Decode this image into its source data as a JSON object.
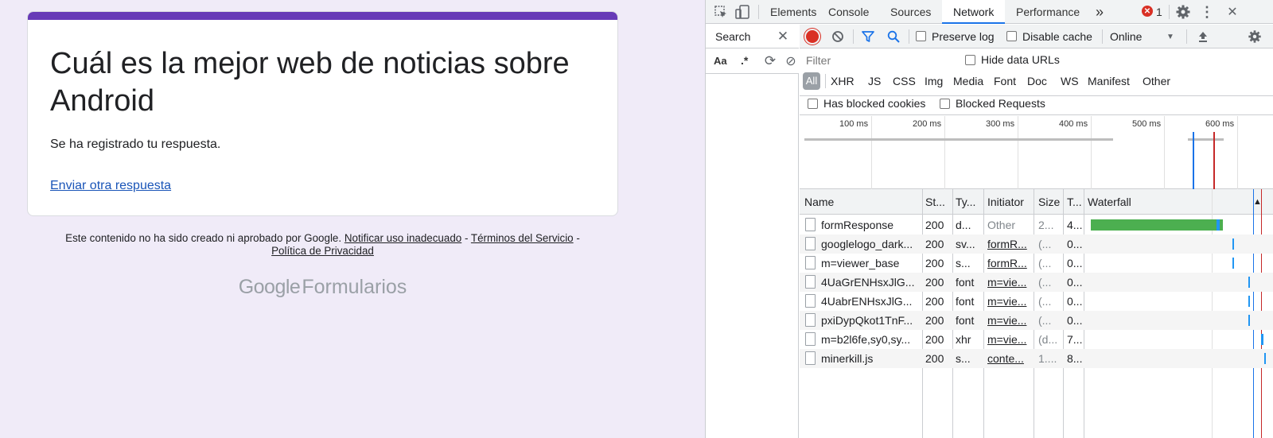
{
  "form": {
    "title": "Cuál es la mejor web de noticias sobre Android",
    "message": "Se ha registrado tu respuesta.",
    "another_link": "Enviar otra respuesta",
    "footer": {
      "disclaimer": "Este contenido no ha sido creado ni aprobado por Google.",
      "report_link": "Notificar uso inadecuado",
      "dash1": " - ",
      "terms_link": "Términos del Servicio",
      "dash2": " -",
      "privacy_link": "Política de Privacidad"
    },
    "brand": {
      "google": "Google",
      "product": "Formularios"
    },
    "colors": {
      "accent": "#673ab7",
      "background": "#f0ebf8"
    }
  },
  "devtools": {
    "tabs": [
      {
        "label": "Elements"
      },
      {
        "label": "Console"
      },
      {
        "label": "Sources"
      },
      {
        "label": "Network",
        "active": true
      },
      {
        "label": "Performance"
      }
    ],
    "more_tabs_glyph": "»",
    "error_count": "1",
    "search": {
      "title": "Search",
      "case_toggle": "Aa",
      "regex_toggle": ".*"
    },
    "network": {
      "preserve_log": "Preserve log",
      "disable_cache": "Disable cache",
      "throttling": "Online",
      "filter_placeholder": "Filter",
      "hide_data_urls": "Hide data URLs",
      "types": [
        "All",
        "XHR",
        "JS",
        "CSS",
        "Img",
        "Media",
        "Font",
        "Doc",
        "WS",
        "Manifest",
        "Other"
      ],
      "has_blocked_cookies": "Has blocked cookies",
      "blocked_requests": "Blocked Requests",
      "overview_ticks": [
        "100 ms",
        "200 ms",
        "300 ms",
        "400 ms",
        "500 ms",
        "600 ms"
      ],
      "columns": {
        "name": "Name",
        "status": "St...",
        "type": "Ty...",
        "initiator": "Initiator",
        "size": "Size",
        "time": "T...",
        "waterfall": "Waterfall"
      },
      "sort_glyph": "▲",
      "rows": [
        {
          "name": "formResponse",
          "status": "200",
          "type": "d...",
          "initiator": "Other",
          "initiator_link": false,
          "size": "2...",
          "time": "4..."
        },
        {
          "name": "googlelogo_dark...",
          "status": "200",
          "type": "sv...",
          "initiator": "formR...",
          "initiator_link": true,
          "size": "(...",
          "time": "0..."
        },
        {
          "name": "m=viewer_base",
          "status": "200",
          "type": "s...",
          "initiator": "formR...",
          "initiator_link": true,
          "size": "(...",
          "time": "0..."
        },
        {
          "name": "4UaGrENHsxJlG...",
          "status": "200",
          "type": "font",
          "initiator": "m=vie...",
          "initiator_link": true,
          "size": "(...",
          "time": "0..."
        },
        {
          "name": "4UabrENHsxJlG...",
          "status": "200",
          "type": "font",
          "initiator": "m=vie...",
          "initiator_link": true,
          "size": "(...",
          "time": "0..."
        },
        {
          "name": "pxiDypQkot1TnF...",
          "status": "200",
          "type": "font",
          "initiator": "m=vie...",
          "initiator_link": true,
          "size": "(...",
          "time": "0..."
        },
        {
          "name": "m=b2l6fe,sy0,sy...",
          "status": "200",
          "type": "xhr",
          "initiator": "m=vie...",
          "initiator_link": true,
          "size": "(d...",
          "time": "7..."
        },
        {
          "name": "minerkill.js",
          "status": "200",
          "type": "s...",
          "initiator": "conte...",
          "initiator_link": true,
          "size": "1....",
          "time": "8..."
        }
      ],
      "colors": {
        "tab_active": "#1a73e8",
        "record": "#d93025",
        "waterfall_bar": "#4caf50",
        "waterfall_end": "#2196f3"
      }
    }
  }
}
